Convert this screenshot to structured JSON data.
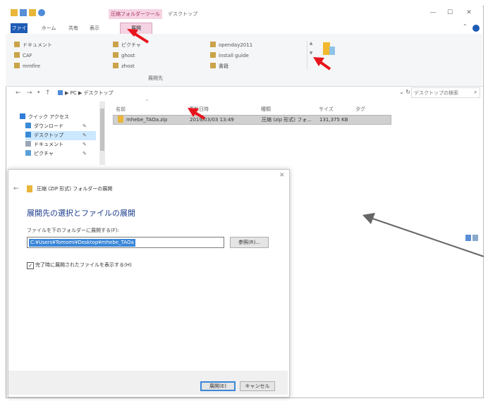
{
  "window": {
    "title": "デスクトップ",
    "context_tab_header": "圧縮フォルダーツール",
    "controls": [
      "—",
      "☐",
      "✕"
    ]
  },
  "ribbon": {
    "tabs": {
      "file": "ファイル",
      "home": "ホーム",
      "share": "共有",
      "view": "表示",
      "extract": "展開"
    },
    "destinations": [
      {
        "label": "ドキュメント"
      },
      {
        "label": "CAF"
      },
      {
        "label": "mmfire"
      },
      {
        "label": "ピクチャ"
      },
      {
        "label": "ghost"
      },
      {
        "label": "zhost"
      },
      {
        "label": "openday2011"
      },
      {
        "label": "install guide"
      },
      {
        "label": "書籍"
      }
    ],
    "group_label": "展開先"
  },
  "addressbar": {
    "path": "▶ PC ▶ デスクトップ",
    "search_placeholder": "デスクトップの検索"
  },
  "navpane": {
    "items": [
      {
        "label": "クイック アクセス",
        "pinned": false
      },
      {
        "label": "ダウンロード",
        "pinned": true
      },
      {
        "label": "デスクトップ",
        "pinned": true,
        "selected": true
      },
      {
        "label": "ドキュメント",
        "pinned": true
      },
      {
        "label": "ピクチャ",
        "pinned": true
      }
    ]
  },
  "filelist": {
    "headers": {
      "name": "名前",
      "date": "更新日時",
      "type": "種類",
      "size": "サイズ",
      "tag": "タグ"
    },
    "rows": [
      {
        "name": "mhebe_TAOa.zip",
        "date": "2019/03/03 13:49",
        "type": "圧縮 (zip 形式) フォ...",
        "size": "131,375 KB"
      }
    ]
  },
  "dialog": {
    "title": "圧縮 (ZIP 形式) フォルダーの展開",
    "heading": "展開先の選択とファイルの展開",
    "path_label": "ファイルを下のフォルダーに展開する(F):",
    "path_value": "C:¥Users¥Tomomi¥Desktop¥mhebe_TAOa",
    "browse_label": "参照(R)...",
    "checkbox_label": "完了時に展開されたファイルを表示する(H)",
    "checkbox_checked": true,
    "extract_label": "展開(E)",
    "cancel_label": "キャンセル",
    "close_glyph": "✕"
  },
  "colors": {
    "accent": "#1e5bb5",
    "context_tab": "#f6d3e2",
    "selection": "#3a86d8",
    "annotation_red": "#e8141c",
    "annotation_gray": "#666666"
  }
}
